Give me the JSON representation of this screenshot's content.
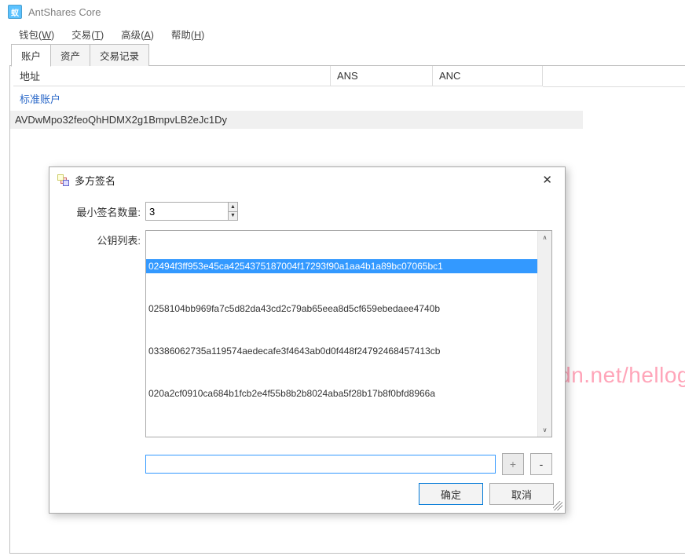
{
  "app": {
    "title": "AntShares Core"
  },
  "menu": {
    "wallet": "钱包",
    "wallet_key": "W",
    "trade": "交易",
    "trade_key": "T",
    "advanced": "高级",
    "advanced_key": "A",
    "help": "帮助",
    "help_key": "H"
  },
  "tabs": {
    "accounts": "账户",
    "assets": "资产",
    "tx": "交易记录"
  },
  "columns": {
    "address": "地址",
    "ans": "ANS",
    "anc": "ANC"
  },
  "group": {
    "standard": "标准账户"
  },
  "rows": {
    "addr0": "AVDwMpo32feoQhHDMX2g1BmpvLB2eJc1Dy"
  },
  "dialog": {
    "title": "多方签名",
    "min_label": "最小签名数量:",
    "min_value": "3",
    "key_label": "公钥列表:",
    "keys": {
      "k0": "02494f3ff953e45ca4254375187004f17293f90a1aa4b1a89bc07065bc1",
      "k1": "0258104bb969fa7c5d82da43cd2c79ab65eea8d5cf659ebedaee4740b",
      "k2": "03386062735a119574aedecafe3f4643ab0d0f448f24792468457413cb",
      "k3": "020a2cf0910ca684b1fcb2e4f55b8b2b8024aba5f28b17b8f0bfd8966a"
    },
    "input_value": "",
    "add": "+",
    "remove": "-",
    "ok": "确定",
    "cancel": "取消"
  },
  "watermark": "http://blog.csdn.net/hellog"
}
